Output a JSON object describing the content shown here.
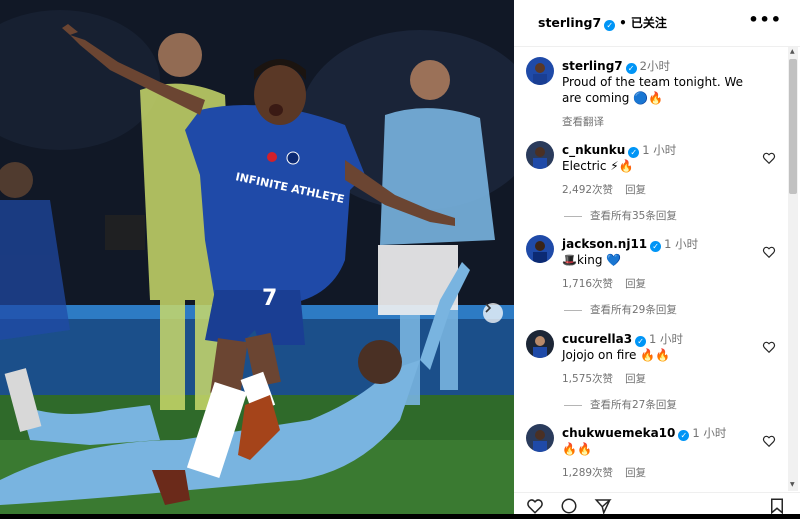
{
  "post": {
    "username": "sterling7",
    "dot": "•",
    "follow_status": "已关注",
    "caption": {
      "username": "sterling7",
      "time": "2小时",
      "text": "Proud of the team tonight. We are coming 🔵🔥",
      "translate": "查看翻译"
    }
  },
  "comments": [
    {
      "username": "c_nkunku",
      "time": "1 小时",
      "text": "Electric ⚡🔥",
      "likes": "2,492次赞",
      "reply": "回复",
      "view_replies": "查看所有35条回复"
    },
    {
      "username": "jackson.nj11",
      "time": "1 小时",
      "text": "🎩king 💙",
      "likes": "1,716次赞",
      "reply": "回复",
      "view_replies": "查看所有29条回复"
    },
    {
      "username": "cucurella3",
      "time": "1 小时",
      "text": "Jojojo on fire 🔥🔥",
      "likes": "1,575次赞",
      "reply": "回复",
      "view_replies": "查看所有27条回复"
    },
    {
      "username": "chukwuemeka10",
      "time": "1 小时",
      "text": "🔥🔥",
      "likes": "1,289次赞",
      "reply": "回复"
    }
  ],
  "photo": {
    "jersey_sponsor": "INFINITE ATHLETE",
    "shirt_number": "7"
  },
  "colors": {
    "chelsea_blue": "#1f4aa8",
    "city_blue": "#79b4e0",
    "pitch_green": "#2f6a2a",
    "verified": "#0095f6"
  }
}
